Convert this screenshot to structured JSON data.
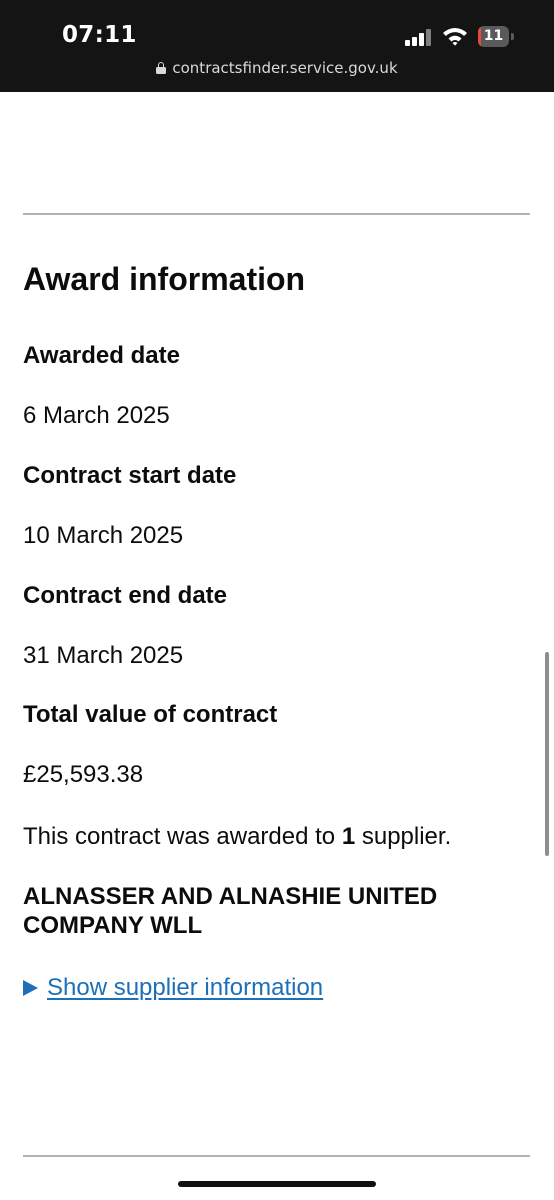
{
  "status_bar": {
    "time": "07:11",
    "battery_level": "11",
    "battery_fraction": 0.11,
    "battery_color": "#e8463f",
    "url": "contractsfinder.service.gov.uk",
    "icons": [
      "cellular-signal-icon",
      "wifi-icon",
      "battery-icon",
      "lock-icon"
    ]
  },
  "award": {
    "heading": "Award information",
    "awarded_date_label": "Awarded date",
    "awarded_date_value": "6 March 2025",
    "start_date_label": "Contract start date",
    "start_date_value": "10 March 2025",
    "end_date_label": "Contract end date",
    "end_date_value": "31 March 2025",
    "total_value_label": "Total value of contract",
    "total_value_value": "£25,593.38",
    "awarded_sentence_before": "This contract was awarded to ",
    "awarded_count": "1",
    "awarded_sentence_after": " supplier.",
    "supplier_name": "ALNASSER AND ALNASHIE UNITED COMPANY WLL",
    "show_supplier_link": "Show supplier information"
  },
  "colors": {
    "link": "#1d70b8",
    "text": "#0b0c0c",
    "divider": "#b1b4b6"
  }
}
